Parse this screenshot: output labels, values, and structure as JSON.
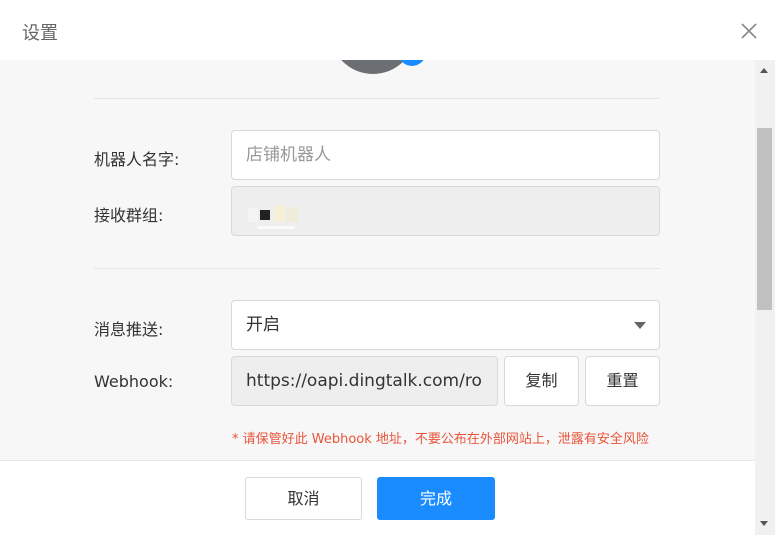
{
  "dialog": {
    "title": "设置"
  },
  "form": {
    "robot_name_label": "机器人名字:",
    "robot_name_placeholder": "店铺机器人",
    "group_label": "接收群组:",
    "push_label": "消息推送:",
    "push_value": "开启",
    "webhook_label": "Webhook:",
    "webhook_value": "https://oapi.dingtalk.com/ro",
    "copy_button": "复制",
    "reset_button": "重置",
    "warning": "* 请保管好此 Webhook 地址，不要公布在外部网站上，泄露有安全风险"
  },
  "footer": {
    "cancel_button": "取消",
    "confirm_button": "完成"
  },
  "colors": {
    "primary": "#1a8cff",
    "warning": "#e8553a"
  }
}
